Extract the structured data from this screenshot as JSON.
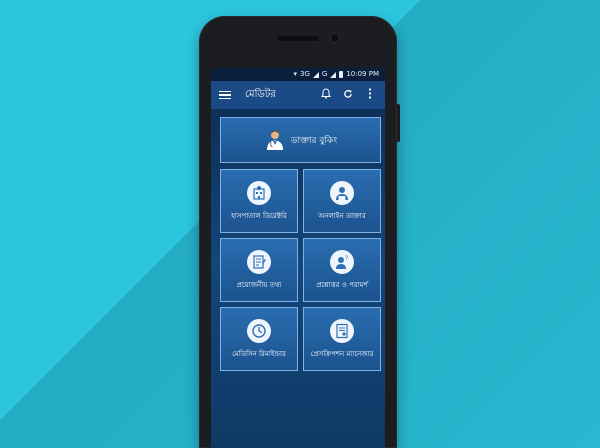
{
  "status": {
    "network": "3G",
    "signal2": "G",
    "time": "10:09 PM"
  },
  "app": {
    "title": "মেডিটর"
  },
  "toolbar": {
    "bell_icon": "bell-icon",
    "refresh_icon": "refresh-icon",
    "more_icon": "more-vert-icon"
  },
  "tiles": {
    "doctor_booking": "ডাক্তার বুকিং",
    "hospital_directory": "হাসপাতাল ডিরেক্টরি",
    "online_doctor": "অনলাইন ডাক্তার",
    "necessary_info": "প্রয়োজনীয় তথ্য",
    "qa_advice": "প্রশ্নোত্তর ও পরামর্শ",
    "medicine_reminder": "মেডিসিন রিমাইন্ডার",
    "prescription_manager": "প্রেসক্রিপশন ম্যানেজার"
  },
  "colors": {
    "background": "#2cc6de",
    "toolbar": "#1b4b86",
    "tile": "#2a6db0",
    "tile_border": "#7fb3e6"
  }
}
